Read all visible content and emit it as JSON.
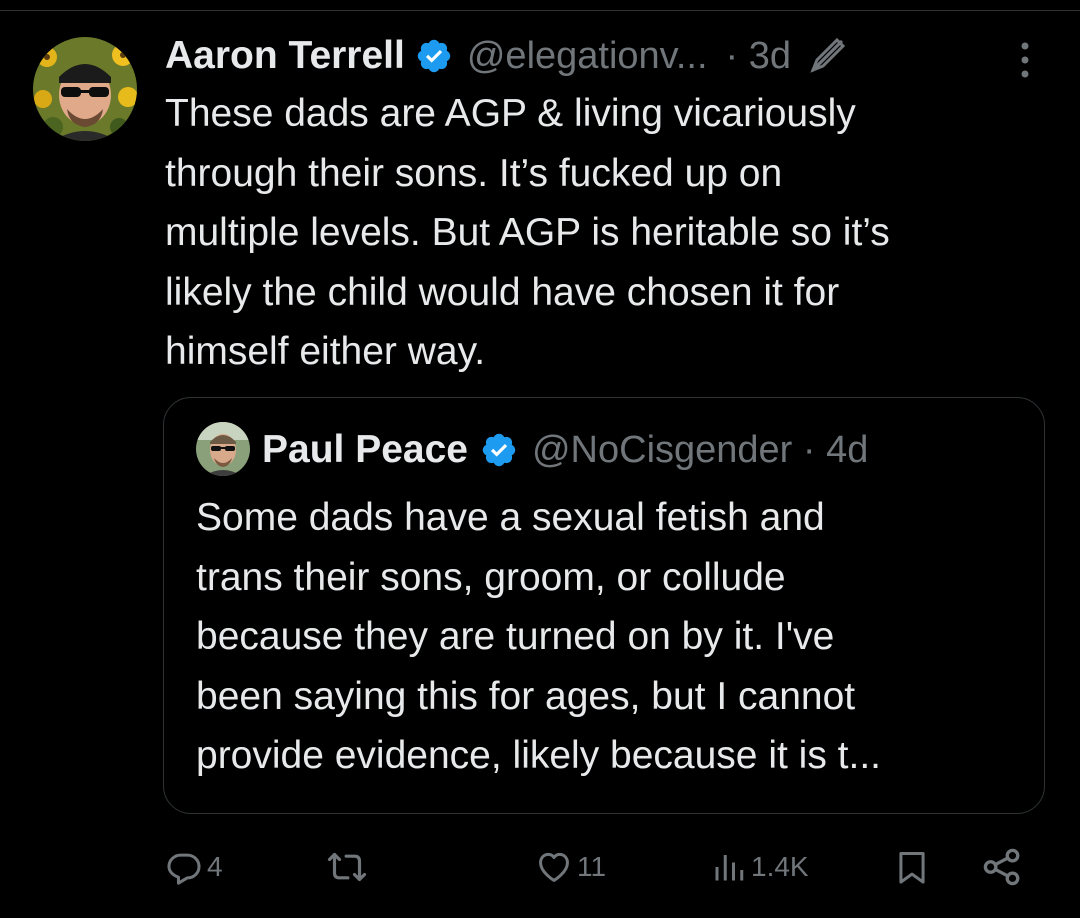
{
  "tweet": {
    "author_name": "Aaron Terrell",
    "author_handle": "@elegationv...",
    "time": "· 3d",
    "text": "These dads are AGP & living vicariously\nthrough their sons. It’s fucked up on\nmultiple levels. But AGP is heritable so it’s\nlikely the child would have chosen it for\nhimself either way."
  },
  "quote": {
    "author_name": "Paul Peace",
    "author_handle": "@NoCisgender",
    "time": "· 4d",
    "text": "Some dads have a sexual fetish and\ntrans their sons, groom, or collude\nbecause they are turned on by it. I've\nbeen saying this for ages, but I cannot\nprovide evidence, likely because it is t..."
  },
  "actions": {
    "replies": "4",
    "retweets": "",
    "likes": "11",
    "views": "1.4K"
  },
  "icons": {
    "verified": "verified-badge-icon",
    "edit": "edited-icon",
    "more": "more-options-icon",
    "reply": "reply-icon",
    "retweet": "retweet-icon",
    "like": "heart-icon",
    "views": "views-icon",
    "bookmark": "bookmark-icon",
    "share": "share-icon"
  },
  "colors": {
    "background": "#000000",
    "text": "#e7e9ea",
    "muted": "#71767b",
    "verified": "#1d9bf0",
    "border": "#2f3336"
  }
}
